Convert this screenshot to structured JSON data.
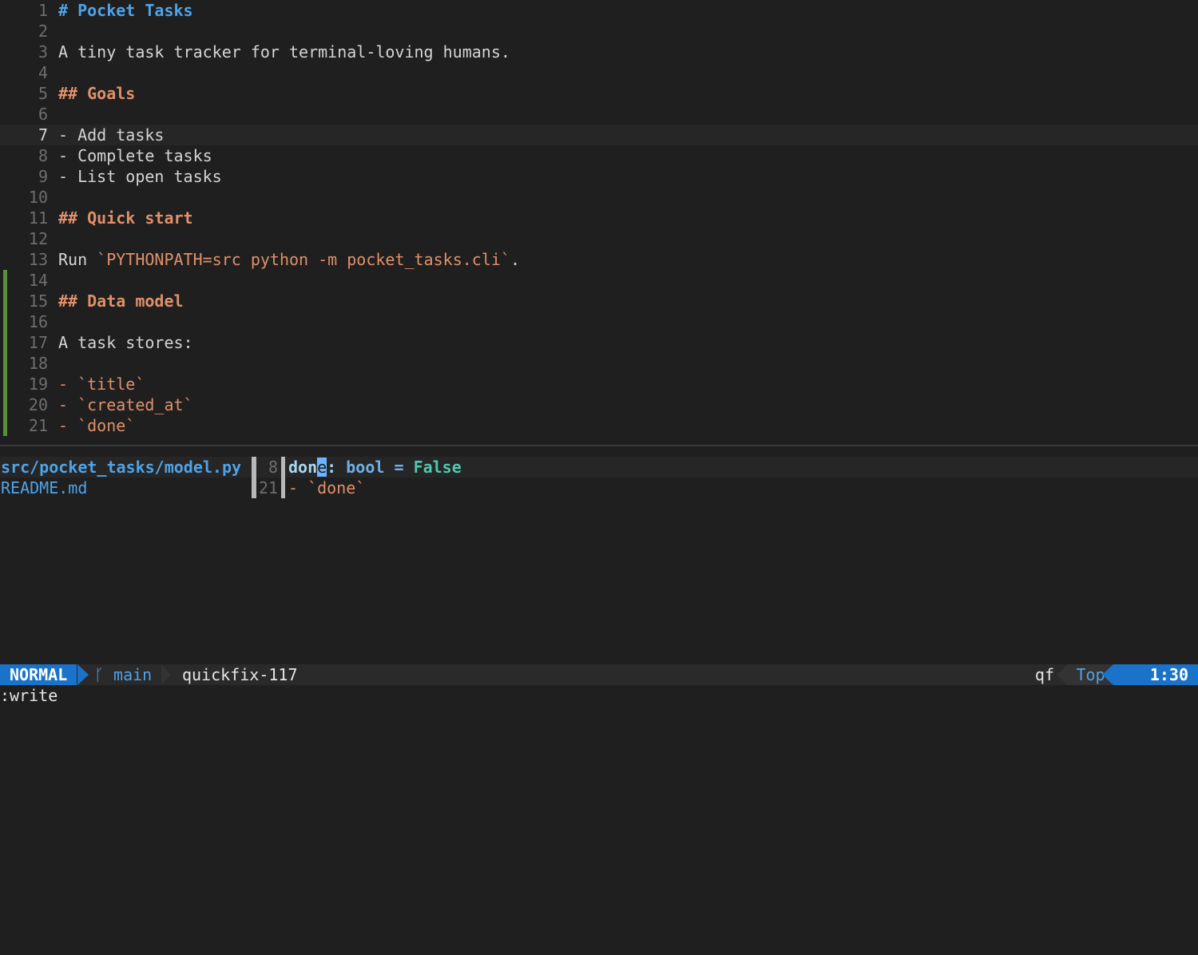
{
  "editor": {
    "lines": [
      {
        "n": "1",
        "segments": [
          {
            "t": "# Pocket Tasks",
            "c": "h1"
          }
        ]
      },
      {
        "n": "2",
        "segments": []
      },
      {
        "n": "3",
        "segments": [
          {
            "t": "A tiny task tracker for terminal-loving humans.",
            "c": ""
          }
        ]
      },
      {
        "n": "4",
        "segments": []
      },
      {
        "n": "5",
        "segments": [
          {
            "t": "## Goals",
            "c": "h2"
          }
        ]
      },
      {
        "n": "6",
        "segments": []
      },
      {
        "n": "7",
        "segments": [
          {
            "t": "- Add tasks",
            "c": ""
          }
        ],
        "cursorline": true
      },
      {
        "n": "8",
        "segments": [
          {
            "t": "- Complete tasks",
            "c": ""
          }
        ]
      },
      {
        "n": "9",
        "segments": [
          {
            "t": "- List open tasks",
            "c": ""
          }
        ]
      },
      {
        "n": "10",
        "segments": []
      },
      {
        "n": "11",
        "segments": [
          {
            "t": "## Quick start",
            "c": "h2"
          }
        ]
      },
      {
        "n": "12",
        "segments": []
      },
      {
        "n": "13",
        "segments": [
          {
            "t": "Run ",
            "c": ""
          },
          {
            "t": "`PYTHONPATH=src python -m pocket_tasks.cli`",
            "c": "code"
          },
          {
            "t": ".",
            "c": ""
          }
        ]
      },
      {
        "n": "14",
        "segments": [],
        "sign": true
      },
      {
        "n": "15",
        "segments": [
          {
            "t": "## Data model",
            "c": "h2"
          }
        ],
        "sign": true
      },
      {
        "n": "16",
        "segments": [],
        "sign": true
      },
      {
        "n": "17",
        "segments": [
          {
            "t": "A task stores:",
            "c": ""
          }
        ],
        "sign": true
      },
      {
        "n": "18",
        "segments": [],
        "sign": true
      },
      {
        "n": "19",
        "segments": [
          {
            "t": "- ",
            "c": "code"
          },
          {
            "t": "`title`",
            "c": "code"
          }
        ],
        "sign": true
      },
      {
        "n": "20",
        "segments": [
          {
            "t": "- ",
            "c": "code"
          },
          {
            "t": "`created_at`",
            "c": "code"
          }
        ],
        "sign": true
      },
      {
        "n": "21",
        "segments": [
          {
            "t": "- ",
            "c": "code"
          },
          {
            "t": "`done`",
            "c": "code"
          }
        ],
        "sign": true
      }
    ]
  },
  "quickfix": {
    "rows": [
      {
        "file": "src/pocket_tasks/model.py",
        "lnum": "8",
        "current": true,
        "segments": [
          {
            "t": "don",
            "c": "ident"
          },
          {
            "t": "e",
            "c": "cursor"
          },
          {
            "t": ": ",
            "c": "ident"
          },
          {
            "t": "bool",
            "c": "kw"
          },
          {
            "t": " = ",
            "c": "kw"
          },
          {
            "t": "False",
            "c": "bool"
          }
        ]
      },
      {
        "file": "README.md",
        "lnum": "21",
        "current": false,
        "segments": [
          {
            "t": "- `done`",
            "c": "code"
          }
        ]
      }
    ]
  },
  "statusline": {
    "mode": "NORMAL",
    "branch_icon": "ᚴ",
    "branch": "main",
    "buffer": "quickfix-117",
    "os_icon": "🐧",
    "separator": "〈",
    "filetype_icon": "≣",
    "filetype": "qf",
    "position": "Top",
    "location": "1:30"
  },
  "cmdline": {
    "text": ":write"
  },
  "colors": {
    "accent": "#1a73c8",
    "heading": "#e0906a",
    "title": "#4fa3e8",
    "git_sign": "#5a8f3c"
  }
}
